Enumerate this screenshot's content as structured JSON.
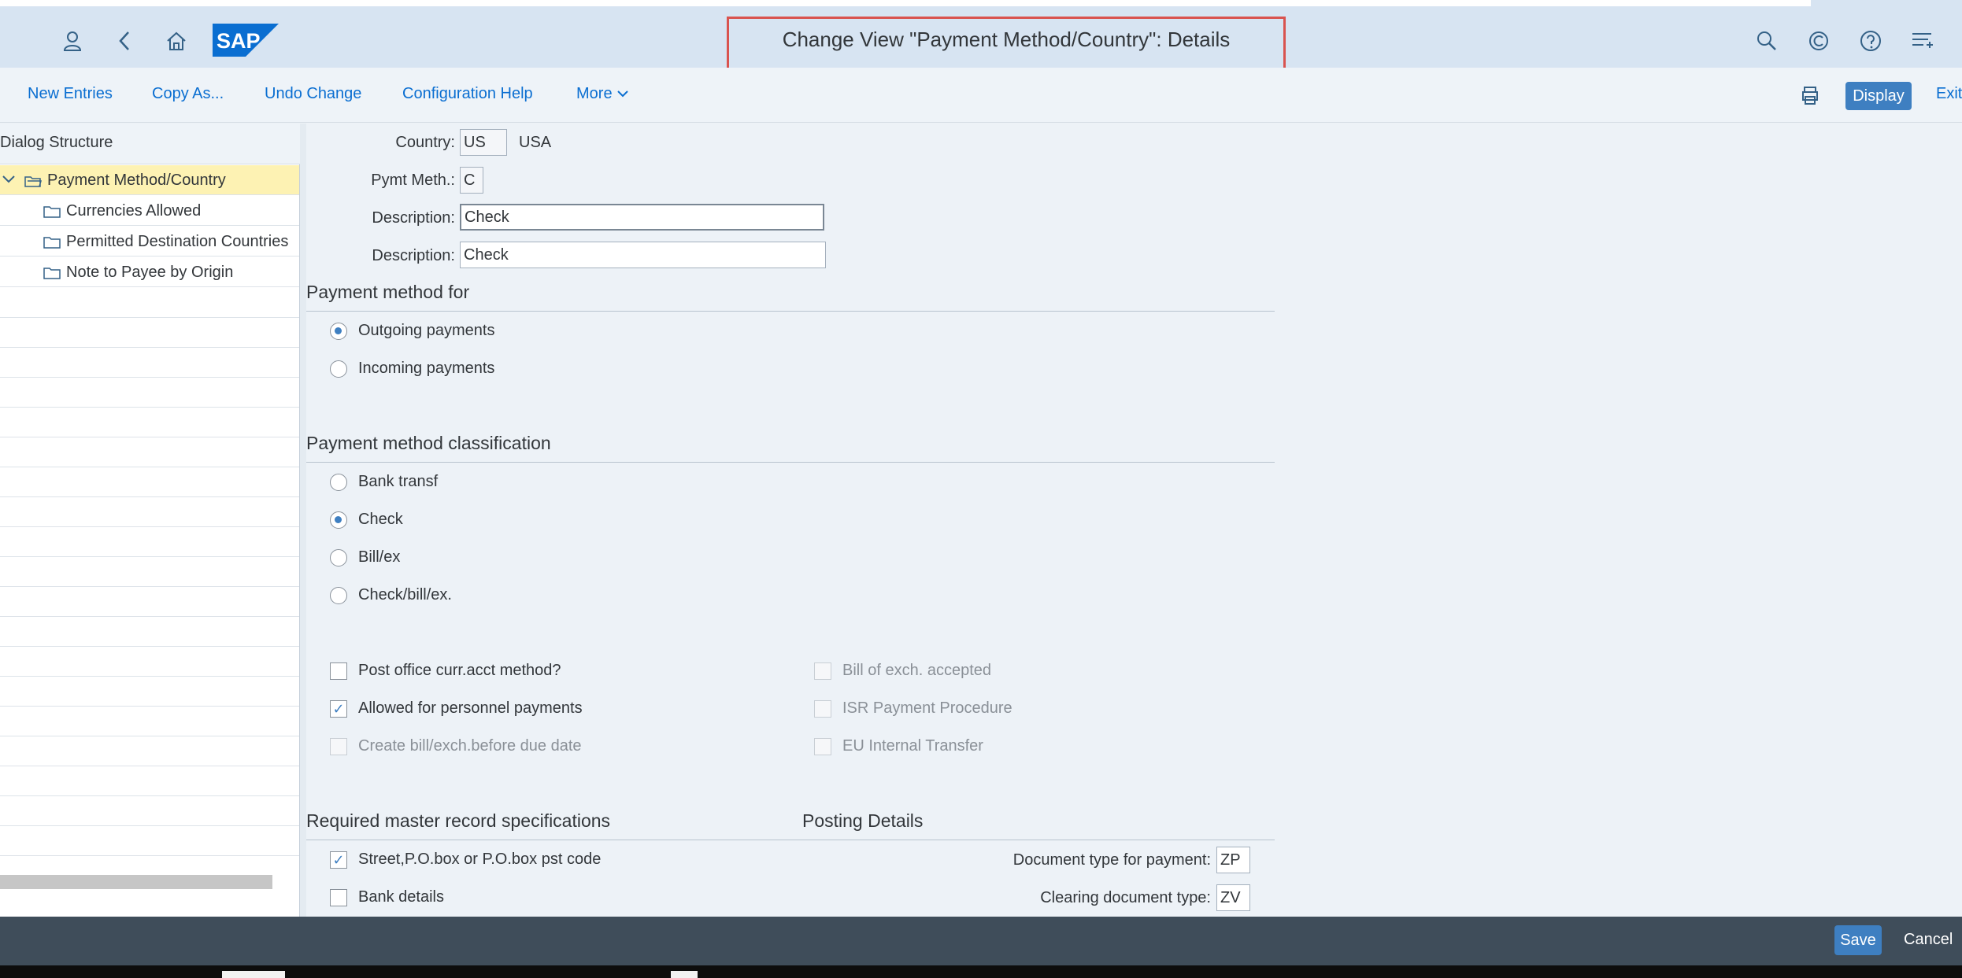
{
  "header": {
    "title": "Change View \"Payment Method/Country\": Details",
    "logo_text": "SAP",
    "icons": [
      "user-icon",
      "back-icon",
      "home-icon",
      "search-icon",
      "copilot-icon",
      "help-icon",
      "notifications-icon"
    ]
  },
  "toolbar": {
    "new_entries": "New Entries",
    "copy_as": "Copy As...",
    "undo_change": "Undo Change",
    "configuration_help": "Configuration Help",
    "more": "More",
    "display": "Display",
    "exit": "Exit"
  },
  "tree": {
    "title": "Dialog Structure",
    "items": [
      {
        "label": "Payment Method/Country",
        "selected": true
      },
      {
        "label": "Currencies Allowed"
      },
      {
        "label": "Permitted Destination Countries"
      },
      {
        "label": "Note to Payee by Origin"
      }
    ]
  },
  "form": {
    "country_label": "Country:",
    "country_value": "US",
    "country_name": "USA",
    "pymt_meth_label": "Pymt Meth.:",
    "pymt_meth_value": "C",
    "description_label": "Description:",
    "description_value_1": "Check",
    "description_value_2": "Check"
  },
  "payment_method_for": {
    "title": "Payment method for",
    "options": [
      {
        "label": "Outgoing payments",
        "selected": true
      },
      {
        "label": "Incoming payments",
        "selected": false
      }
    ]
  },
  "classification": {
    "title": "Payment method classification",
    "options": [
      {
        "label": "Bank transf",
        "selected": false
      },
      {
        "label": "Check",
        "selected": true
      },
      {
        "label": "Bill/ex",
        "selected": false
      },
      {
        "label": "Check/bill/ex.",
        "selected": false
      }
    ]
  },
  "flags": {
    "left": [
      {
        "label": "Post office curr.acct method?",
        "checked": false,
        "enabled": true
      },
      {
        "label": "Allowed for personnel payments",
        "checked": true,
        "enabled": true
      },
      {
        "label": "Create bill/exch.before due date",
        "checked": false,
        "enabled": false
      }
    ],
    "right": [
      {
        "label": "Bill of exch. accepted",
        "checked": false,
        "enabled": false
      },
      {
        "label": "ISR Payment Procedure",
        "checked": false,
        "enabled": false
      },
      {
        "label": "EU Internal Transfer",
        "checked": false,
        "enabled": false
      }
    ]
  },
  "master_record": {
    "title": "Required master record specifications",
    "items": [
      {
        "label": "Street,P.O.box or P.O.box pst code",
        "checked": true
      },
      {
        "label": "Bank details",
        "checked": false
      }
    ]
  },
  "posting": {
    "title": "Posting Details",
    "doc_type_label": "Document type for payment:",
    "doc_type_value": "ZP",
    "clearing_label": "Clearing document type:",
    "clearing_value": "ZV"
  },
  "footer": {
    "save": "Save",
    "cancel": "Cancel"
  },
  "colors": {
    "accent": "#3e7fc1",
    "shell": "#d7e4f2",
    "highlight_box": "#d9534f",
    "selected_row": "#fdf2b3"
  }
}
